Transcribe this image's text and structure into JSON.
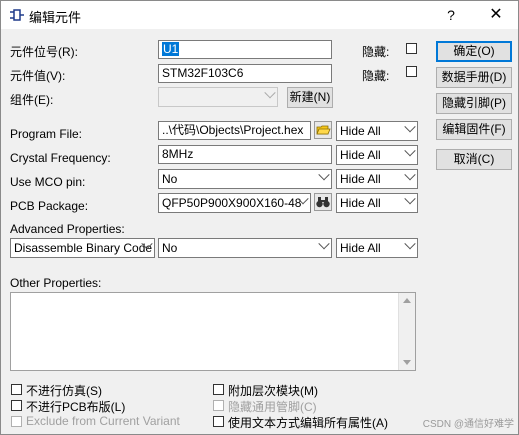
{
  "window": {
    "title": "编辑元件",
    "help_glyph": "?",
    "close_glyph": "✕"
  },
  "fields": {
    "ref_label": "元件位号(R):",
    "ref_value": "U1",
    "ref_hide_label": "隐藏:",
    "value_label": "元件值(V):",
    "value_value": "STM32F103C6",
    "value_hide_label": "隐藏:",
    "group_label": "组件(E):",
    "group_value": "",
    "new_button": "新建(N)"
  },
  "properties": [
    {
      "label": "Program File:",
      "value": "..\\代码\\Objects\\Project.hex",
      "visibility": "Hide All"
    },
    {
      "label": "Crystal Frequency:",
      "value": "8MHz",
      "visibility": "Hide All"
    },
    {
      "label": "Use MCO pin:",
      "value": "No",
      "visibility": "Hide All"
    },
    {
      "label": "PCB Package:",
      "value": "QFP50P900X900X160-48",
      "visibility": "Hide All"
    }
  ],
  "advanced": {
    "heading": "Advanced Properties:",
    "name": "Disassemble Binary Code",
    "value": "No",
    "visibility": "Hide All"
  },
  "other": {
    "label": "Other Properties:",
    "text": ""
  },
  "buttons": {
    "ok": "确定(O)",
    "datasheet": "数据手册(D)",
    "hide_pins": "隐藏引脚(P)",
    "edit_firmware": "编辑固件(F)",
    "cancel": "取消(C)"
  },
  "options": {
    "exclude_sim": "不进行仿真(S)",
    "exclude_pcb": "不进行PCB布版(L)",
    "exclude_variant": "Exclude from Current Variant",
    "hierarchy_module": "附加层次模块(M)",
    "hide_common_pins": "隐藏通用管脚(C)",
    "edit_all_props": "使用文本方式编辑所有属性(A)"
  },
  "watermark": "CSDN @通信好难学",
  "colors": {
    "accent": "#0078d7",
    "dialog_bg": "#f0f0f0"
  }
}
